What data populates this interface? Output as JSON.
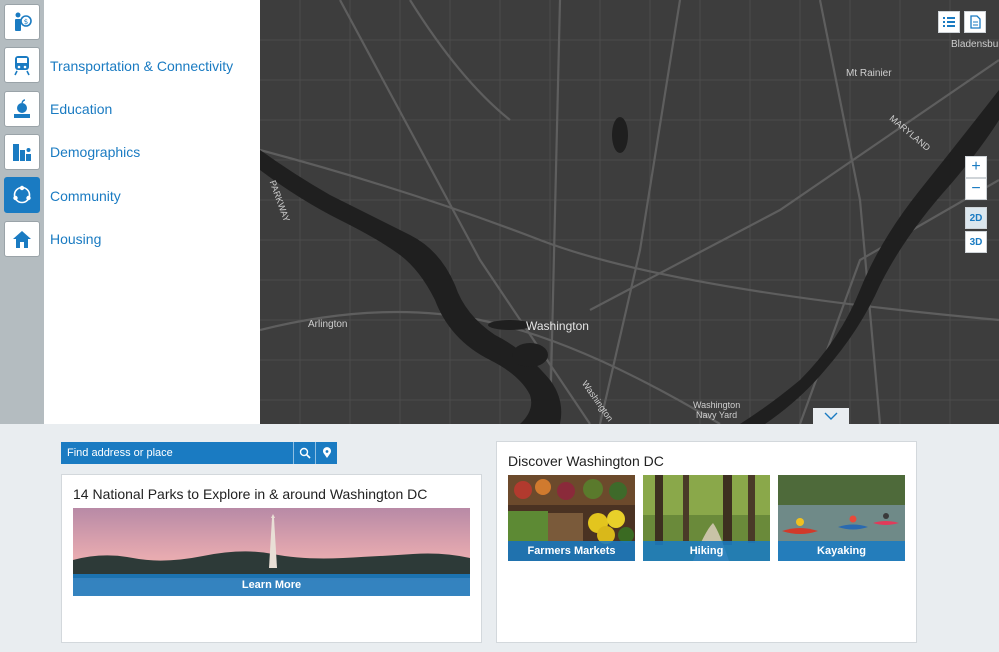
{
  "sidebar": {
    "items": [
      {
        "icon": "money-person-icon",
        "label": ""
      },
      {
        "icon": "train-icon",
        "label": "Transportation & Connectivity"
      },
      {
        "icon": "apple-icon",
        "label": "Education"
      },
      {
        "icon": "chart-people-icon",
        "label": "Demographics"
      },
      {
        "icon": "community-circle-icon",
        "label": "Community"
      },
      {
        "icon": "house-icon",
        "label": "Housing"
      }
    ],
    "active_index": 4
  },
  "map": {
    "labels": {
      "bladensburg": "Bladensburg",
      "mt_rainier": "Mt Rainier",
      "maryland": "MARYLAND",
      "arlington": "Arlington",
      "washington": "Washington",
      "navy_yard_line1": "Washington",
      "navy_yard_line2": "Navy Yard",
      "parkway": "PARKWAY",
      "river": "Washington"
    },
    "controls": {
      "zoom_in": "+",
      "zoom_out": "−",
      "mode_2d": "2D",
      "mode_3d": "3D",
      "active_mode": "2D"
    },
    "top_icons": [
      "list-icon",
      "document-icon"
    ]
  },
  "search": {
    "placeholder": "Find address or place"
  },
  "parks_card": {
    "title": "14 National Parks to Explore in & around Washington DC",
    "button_label": "Learn More"
  },
  "discover_card": {
    "title": "Discover Washington DC",
    "tiles": [
      {
        "label": "Farmers Markets"
      },
      {
        "label": "Hiking"
      },
      {
        "label": "Kayaking"
      }
    ]
  },
  "colors": {
    "accent": "#1a7bc2",
    "map_bg": "#3d3d3d",
    "page_bg": "#e9edf0"
  }
}
